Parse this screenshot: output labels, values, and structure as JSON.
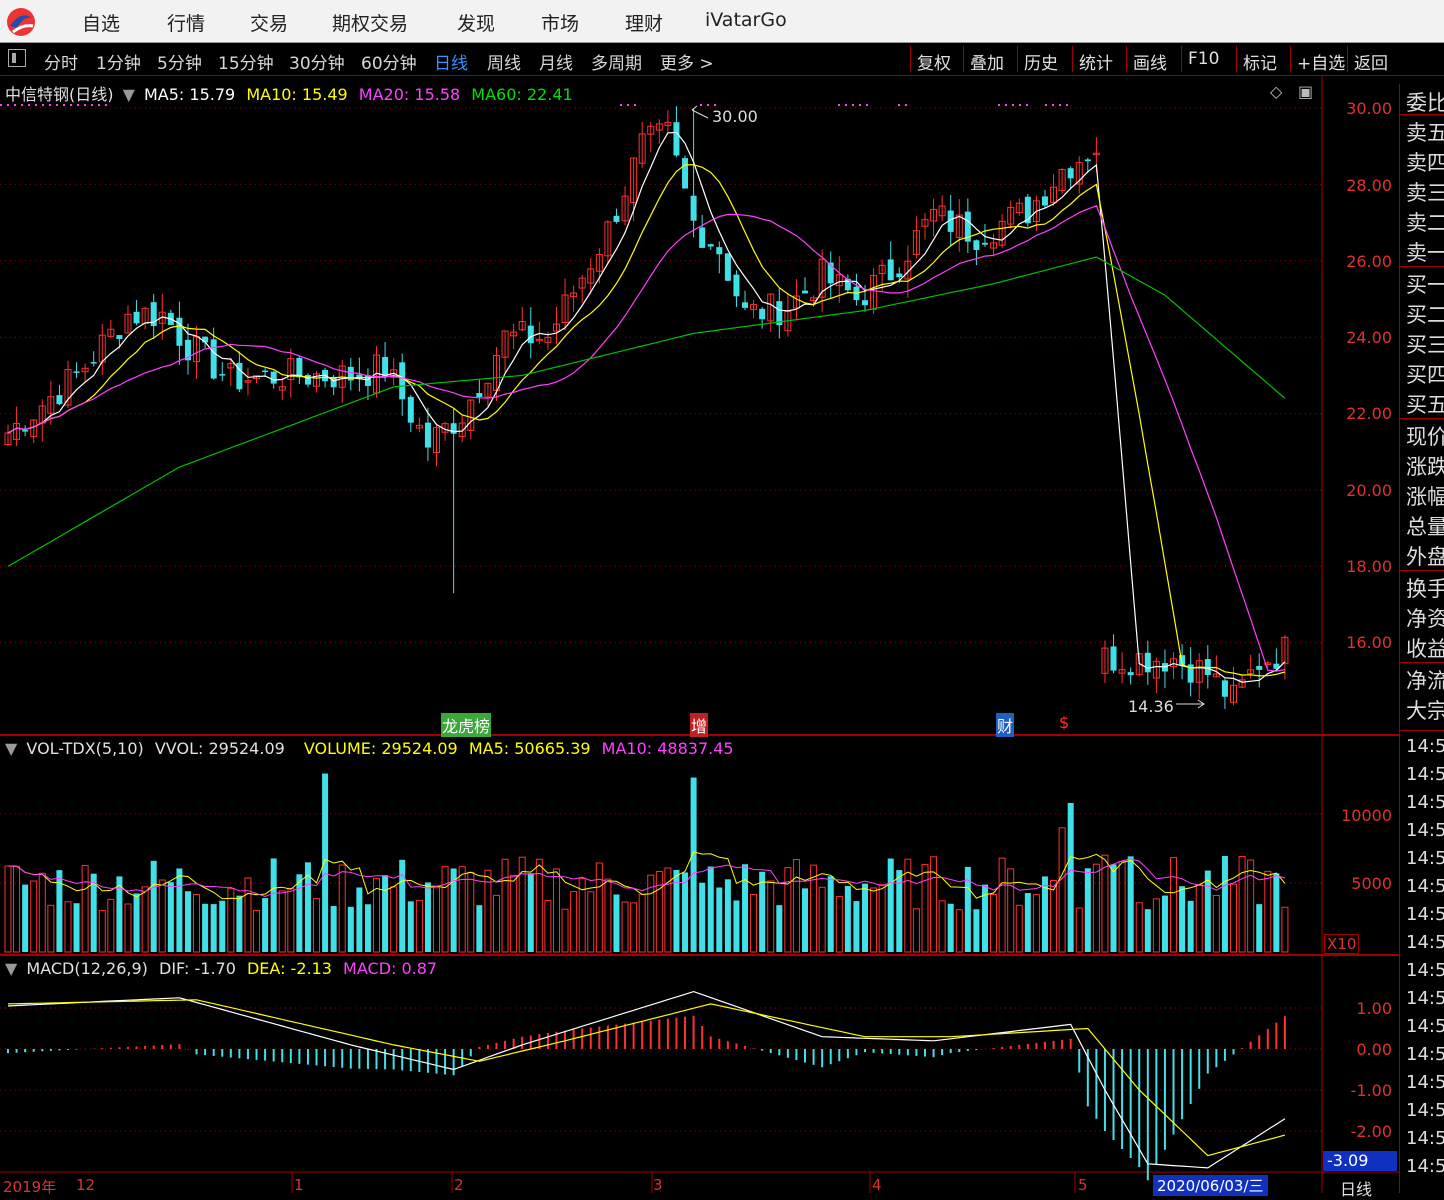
{
  "menubar": {
    "items": [
      "自选",
      "行情",
      "交易",
      "期权交易",
      "发现",
      "市场",
      "理财",
      "iVatarGo"
    ]
  },
  "toolbar": {
    "periods": [
      "分时",
      "1分钟",
      "5分钟",
      "15分钟",
      "30分钟",
      "60分钟",
      "日线",
      "周线",
      "月线",
      "多周期",
      "更多 >"
    ],
    "active_period": "日线",
    "buttons": [
      "复权",
      "叠加",
      "历史",
      "统计",
      "画线",
      "F10",
      "标记",
      "+自选",
      "返回"
    ]
  },
  "main_chart": {
    "stock_title": "中信特钢(日线)",
    "ma5_label": "MA5: 15.79",
    "ma10_label": "MA10: 15.49",
    "ma20_label": "MA20: 15.58",
    "ma60_label": "MA60: 22.41",
    "high_marker": "30.00",
    "low_marker": "14.36",
    "y_ticks": [
      "30.00",
      "28.00",
      "26.00",
      "24.00",
      "22.00",
      "20.00",
      "18.00",
      "16.00"
    ],
    "events": [
      {
        "label": "龙虎榜",
        "color": "#3aa83a"
      },
      {
        "label": "增",
        "color": "#c02020"
      },
      {
        "label": "财",
        "color": "#2060c0"
      },
      {
        "label": "$",
        "color": "#ff3030"
      }
    ]
  },
  "volume_chart": {
    "title": "VOL-TDX(5,10)",
    "vvol": "VVOL: 29524.09",
    "volume": "VOLUME: 29524.09",
    "ma5": "MA5: 50665.39",
    "ma10": "MA10: 48837.45",
    "y_ticks": [
      "10000",
      "5000"
    ],
    "unit": "X10"
  },
  "macd_chart": {
    "title": "MACD(12,26,9)",
    "dif": "DIF: -1.70",
    "dea": "DEA: -2.13",
    "macd": "MACD: 0.87",
    "y_ticks": [
      "1.00",
      "0.00",
      "-1.00",
      "-2.00"
    ],
    "current_value": "-3.09"
  },
  "time_axis": {
    "labels": [
      "2019年",
      "12",
      "1",
      "2",
      "3",
      "4",
      "5"
    ],
    "cursor_date": "2020/06/03/三",
    "period_label": "日线"
  },
  "right_panel": {
    "labels": [
      "委比",
      "卖五",
      "卖四",
      "卖三",
      "卖二",
      "卖一",
      "买一",
      "买二",
      "买三",
      "买四",
      "买五",
      "现价",
      "涨跌",
      "涨幅",
      "总量",
      "外盘",
      "换手",
      "净资",
      "收益",
      "净流",
      "大宗"
    ],
    "times": [
      "14:5",
      "14:5",
      "14:5",
      "14:5",
      "14:5",
      "14:5",
      "14:5",
      "14:5",
      "14:5",
      "14:5",
      "14:5",
      "14:5",
      "14:5",
      "14:5",
      "14:5",
      "14:5"
    ]
  },
  "colors": {
    "up": "#ff3030",
    "down": "#40e0e8",
    "ma5": "#ffffff",
    "ma10": "#ffff00",
    "ma20": "#ff40ff",
    "ma60": "#00c000",
    "grid": "#a00000"
  },
  "chart_data": {
    "type": "candlestick",
    "price_axis_range": [
      14.0,
      30.5
    ],
    "volume_axis_range": [
      0,
      14000
    ],
    "macd_axis_range": [
      -3.0,
      1.6
    ],
    "anchors": [
      [
        0,
        21.5
      ],
      [
        8,
        23.0
      ],
      [
        14,
        24.6
      ],
      [
        18,
        24.6
      ],
      [
        21,
        23.8
      ],
      [
        26,
        22.9
      ],
      [
        32,
        23.0
      ],
      [
        40,
        23.0
      ],
      [
        44,
        23.2
      ],
      [
        49,
        21.2
      ],
      [
        53,
        22.0
      ],
      [
        58,
        24.0
      ],
      [
        63,
        24.0
      ],
      [
        70,
        26.8
      ],
      [
        74,
        29.0
      ],
      [
        77,
        29.3
      ],
      [
        80,
        27.0
      ],
      [
        83,
        26.3
      ],
      [
        86,
        24.6
      ],
      [
        91,
        24.8
      ],
      [
        95,
        25.6
      ],
      [
        99,
        25.0
      ],
      [
        103,
        25.7
      ],
      [
        108,
        27.2
      ],
      [
        113,
        26.7
      ],
      [
        119,
        27.3
      ],
      [
        123,
        28.4
      ],
      [
        127,
        29.0
      ],
      [
        128,
        15.6
      ],
      [
        136,
        15.6
      ],
      [
        140,
        15.2
      ],
      [
        143,
        14.5
      ],
      [
        146,
        15.5
      ],
      [
        149,
        15.8
      ]
    ],
    "ma60_anchors": [
      [
        0,
        18.0
      ],
      [
        20,
        20.6
      ],
      [
        45,
        22.7
      ],
      [
        60,
        23.0
      ],
      [
        80,
        24.1
      ],
      [
        100,
        24.7
      ],
      [
        115,
        25.4
      ],
      [
        127,
        26.1
      ],
      [
        135,
        25.1
      ],
      [
        149,
        22.4
      ]
    ]
  }
}
